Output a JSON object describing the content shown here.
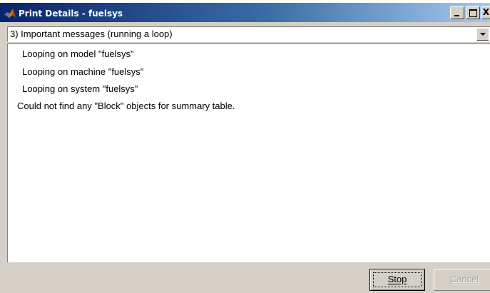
{
  "window": {
    "title": "Print Details - fuelsys",
    "icon": "matlab-logo-icon",
    "controls": {
      "minimize": "minimize-icon",
      "maximize": "maximize-icon",
      "close_visible": "X"
    }
  },
  "detail_level": {
    "selected": "3) Important messages (running a loop)"
  },
  "messages": [
    "Looping on model \"fuelsys\"",
    "Looping on machine \"fuelsys\"",
    "Looping on system \"fuelsys\"",
    "Could not find any \"Block\" objects for summary table."
  ],
  "buttons": {
    "stop": "Stop",
    "cancel": "Cancel"
  },
  "colors": {
    "title_bar_start": "#0a246a",
    "title_bar_end": "#a6caf0",
    "face": "#d4d0c8",
    "disabled_text": "#a0a0a0"
  }
}
